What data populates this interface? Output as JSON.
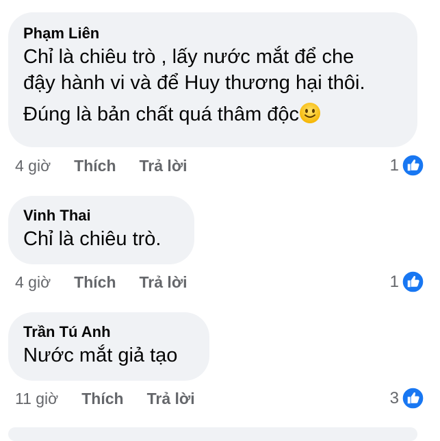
{
  "comments": [
    {
      "author": "Phạm Liên",
      "lines": [
        "Chỉ là chiêu trò , lấy nước mắt để che",
        "đậy hành vi và để Huy thương hại thôi."
      ],
      "line3": "Đúng là bản chất quá thâm độc",
      "emoji": "slightly-smiling-face-icon",
      "time": "4 giờ",
      "like_label": "Thích",
      "reply_label": "Trả lời",
      "reaction_count": "1"
    },
    {
      "author": "Vinh Thai",
      "text": "Chỉ là chiêu trò.",
      "time": "4 giờ",
      "like_label": "Thích",
      "reply_label": "Trả lời",
      "reaction_count": "1"
    },
    {
      "author": "Trần Tú Anh",
      "text": "Nước mắt giả tạo",
      "time": "11 giờ",
      "like_label": "Thích",
      "reply_label": "Trả lời",
      "reaction_count": "3"
    }
  ],
  "colors": {
    "bubble": "#f0f2f5",
    "meta": "#65676b",
    "like_blue": "#1877f2"
  }
}
